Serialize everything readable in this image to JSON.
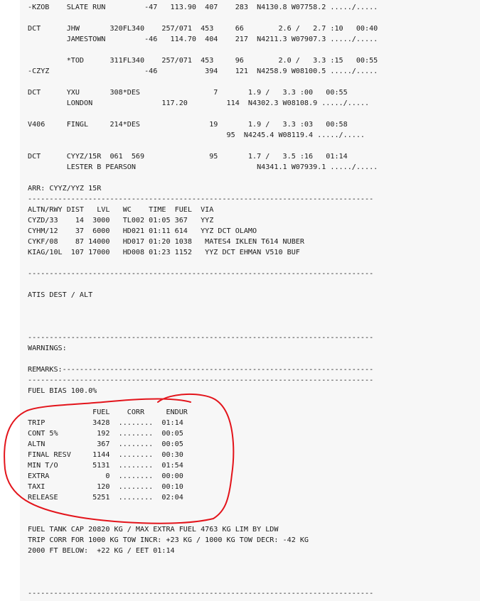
{
  "ofp": {
    "lines": [
      "-KZOB    SLATE RUN         -47   113.90  407    283  N4130.8 W07758.2 ...../.....",
      "",
      "DCT      JHW       320FL340    257/071  453     66        2.6 /   2.7 :10   00:40",
      "         JAMESTOWN         -46   114.70  404    217  N4211.3 W07907.3 ...../.....",
      "",
      "         *TOD      311FL340    257/071  453     96        2.0 /   3.3 :15   00:55",
      "-CZYZ                      -46           394    121  N4258.9 W08100.5 ...../.....",
      "",
      "DCT      YXU       308*DES                 7       1.9 /   3.3 :00   00:55",
      "         LONDON                117.20         114  N4302.3 W08108.9 ...../.....",
      "",
      "V406     FINGL     214*DES                19       1.9 /   3.3 :03   00:58",
      "                                              95  N4245.4 W08119.4 ...../.....",
      "",
      "DCT      CYYZ/15R  061  569               95       1.7 /   3.5 :16   01:14",
      "         LESTER B PEARSON                            N4341.1 W07939.1 ...../.....",
      "",
      "ARR: CYYZ/YYZ 15R",
      "--------------------------------------------------------------------------------",
      "ALTN/RWY DIST   LVL   WC    TIME  FUEL  VIA",
      "CYZD/33    14  3000   TL002 01:05 367   YYZ",
      "CYHM/12    37  6000   HD021 01:11 614   YYZ DCT OLAMO",
      "CYKF/08    87 14000   HD017 01:20 1038   MATES4 IKLEN T614 NUBER",
      "KIAG/10L  107 17000   HD008 01:23 1152   YYZ DCT EHMAN V510 BUF",
      "",
      "--------------------------------------------------------------------------------",
      "",
      "ATIS DEST / ALT",
      "",
      "",
      "",
      "--------------------------------------------------------------------------------",
      "WARNINGS:",
      "",
      "REMARKS:------------------------------------------------------------------------",
      "--------------------------------------------------------------------------------",
      "FUEL BIAS 100.0%",
      "",
      "               FUEL    CORR     ENDUR",
      "TRIP           3428  ........  01:14",
      "CONT 5%         192  ........  00:05",
      "ALTN            367  ........  00:05",
      "FINAL RESV     1144  ........  00:30",
      "MIN T/O        5131  ........  01:54",
      "EXTRA             0  ........  00:00",
      "TAXI            120  ........  00:10",
      "RELEASE        5251  ........  02:04",
      "",
      "",
      "FUEL TANK CAP 20820 KG / MAX EXTRA FUEL 4763 KG LIM BY LDW",
      "TRIP CORR FOR 1000 KG TOW INCR: +23 KG / 1000 KG TOW DECR: -42 KG",
      "2000 FT BELOW:  +22 KG / EET 01:14",
      "",
      "",
      "",
      "--------------------------------------------------------------------------------"
    ]
  },
  "annotation": {
    "color": "#e3141b",
    "shape": "hand-drawn circle around fuel summary table"
  }
}
